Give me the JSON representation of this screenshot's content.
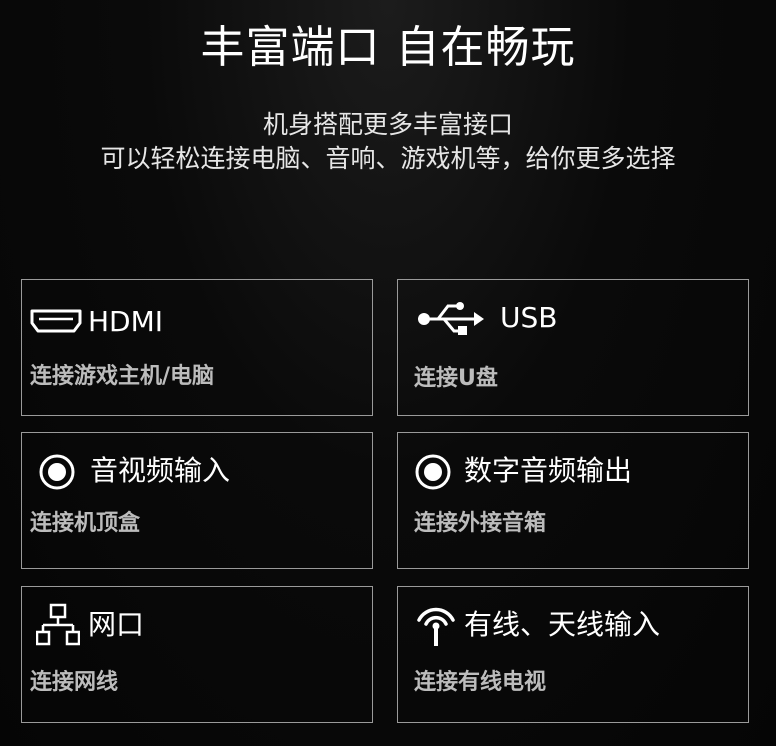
{
  "header": {
    "title": "丰富端口 自在畅玩",
    "subtitle_line1": "机身搭配更多丰富接口",
    "subtitle_line2": "可以轻松连接电脑、音响、游戏机等，给你更多选择"
  },
  "ports": [
    {
      "name": "HDMI",
      "description": "连接游戏主机/电脑",
      "icon": "hdmi-icon"
    },
    {
      "name": "USB",
      "description": "连接U盘",
      "icon": "usb-icon"
    },
    {
      "name": "音视频输入",
      "description": "连接机顶盒",
      "icon": "av-input-icon"
    },
    {
      "name": "数字音频输出",
      "description": "连接外接音箱",
      "icon": "digital-audio-icon"
    },
    {
      "name": "网口",
      "description": "连接网线",
      "icon": "network-icon"
    },
    {
      "name": "有线、天线输入",
      "description": "连接有线电视",
      "icon": "antenna-icon"
    }
  ],
  "colors": {
    "background": "#050505",
    "border": "#9a9a9a",
    "title": "#ffffff",
    "description": "#bcbcbc"
  }
}
